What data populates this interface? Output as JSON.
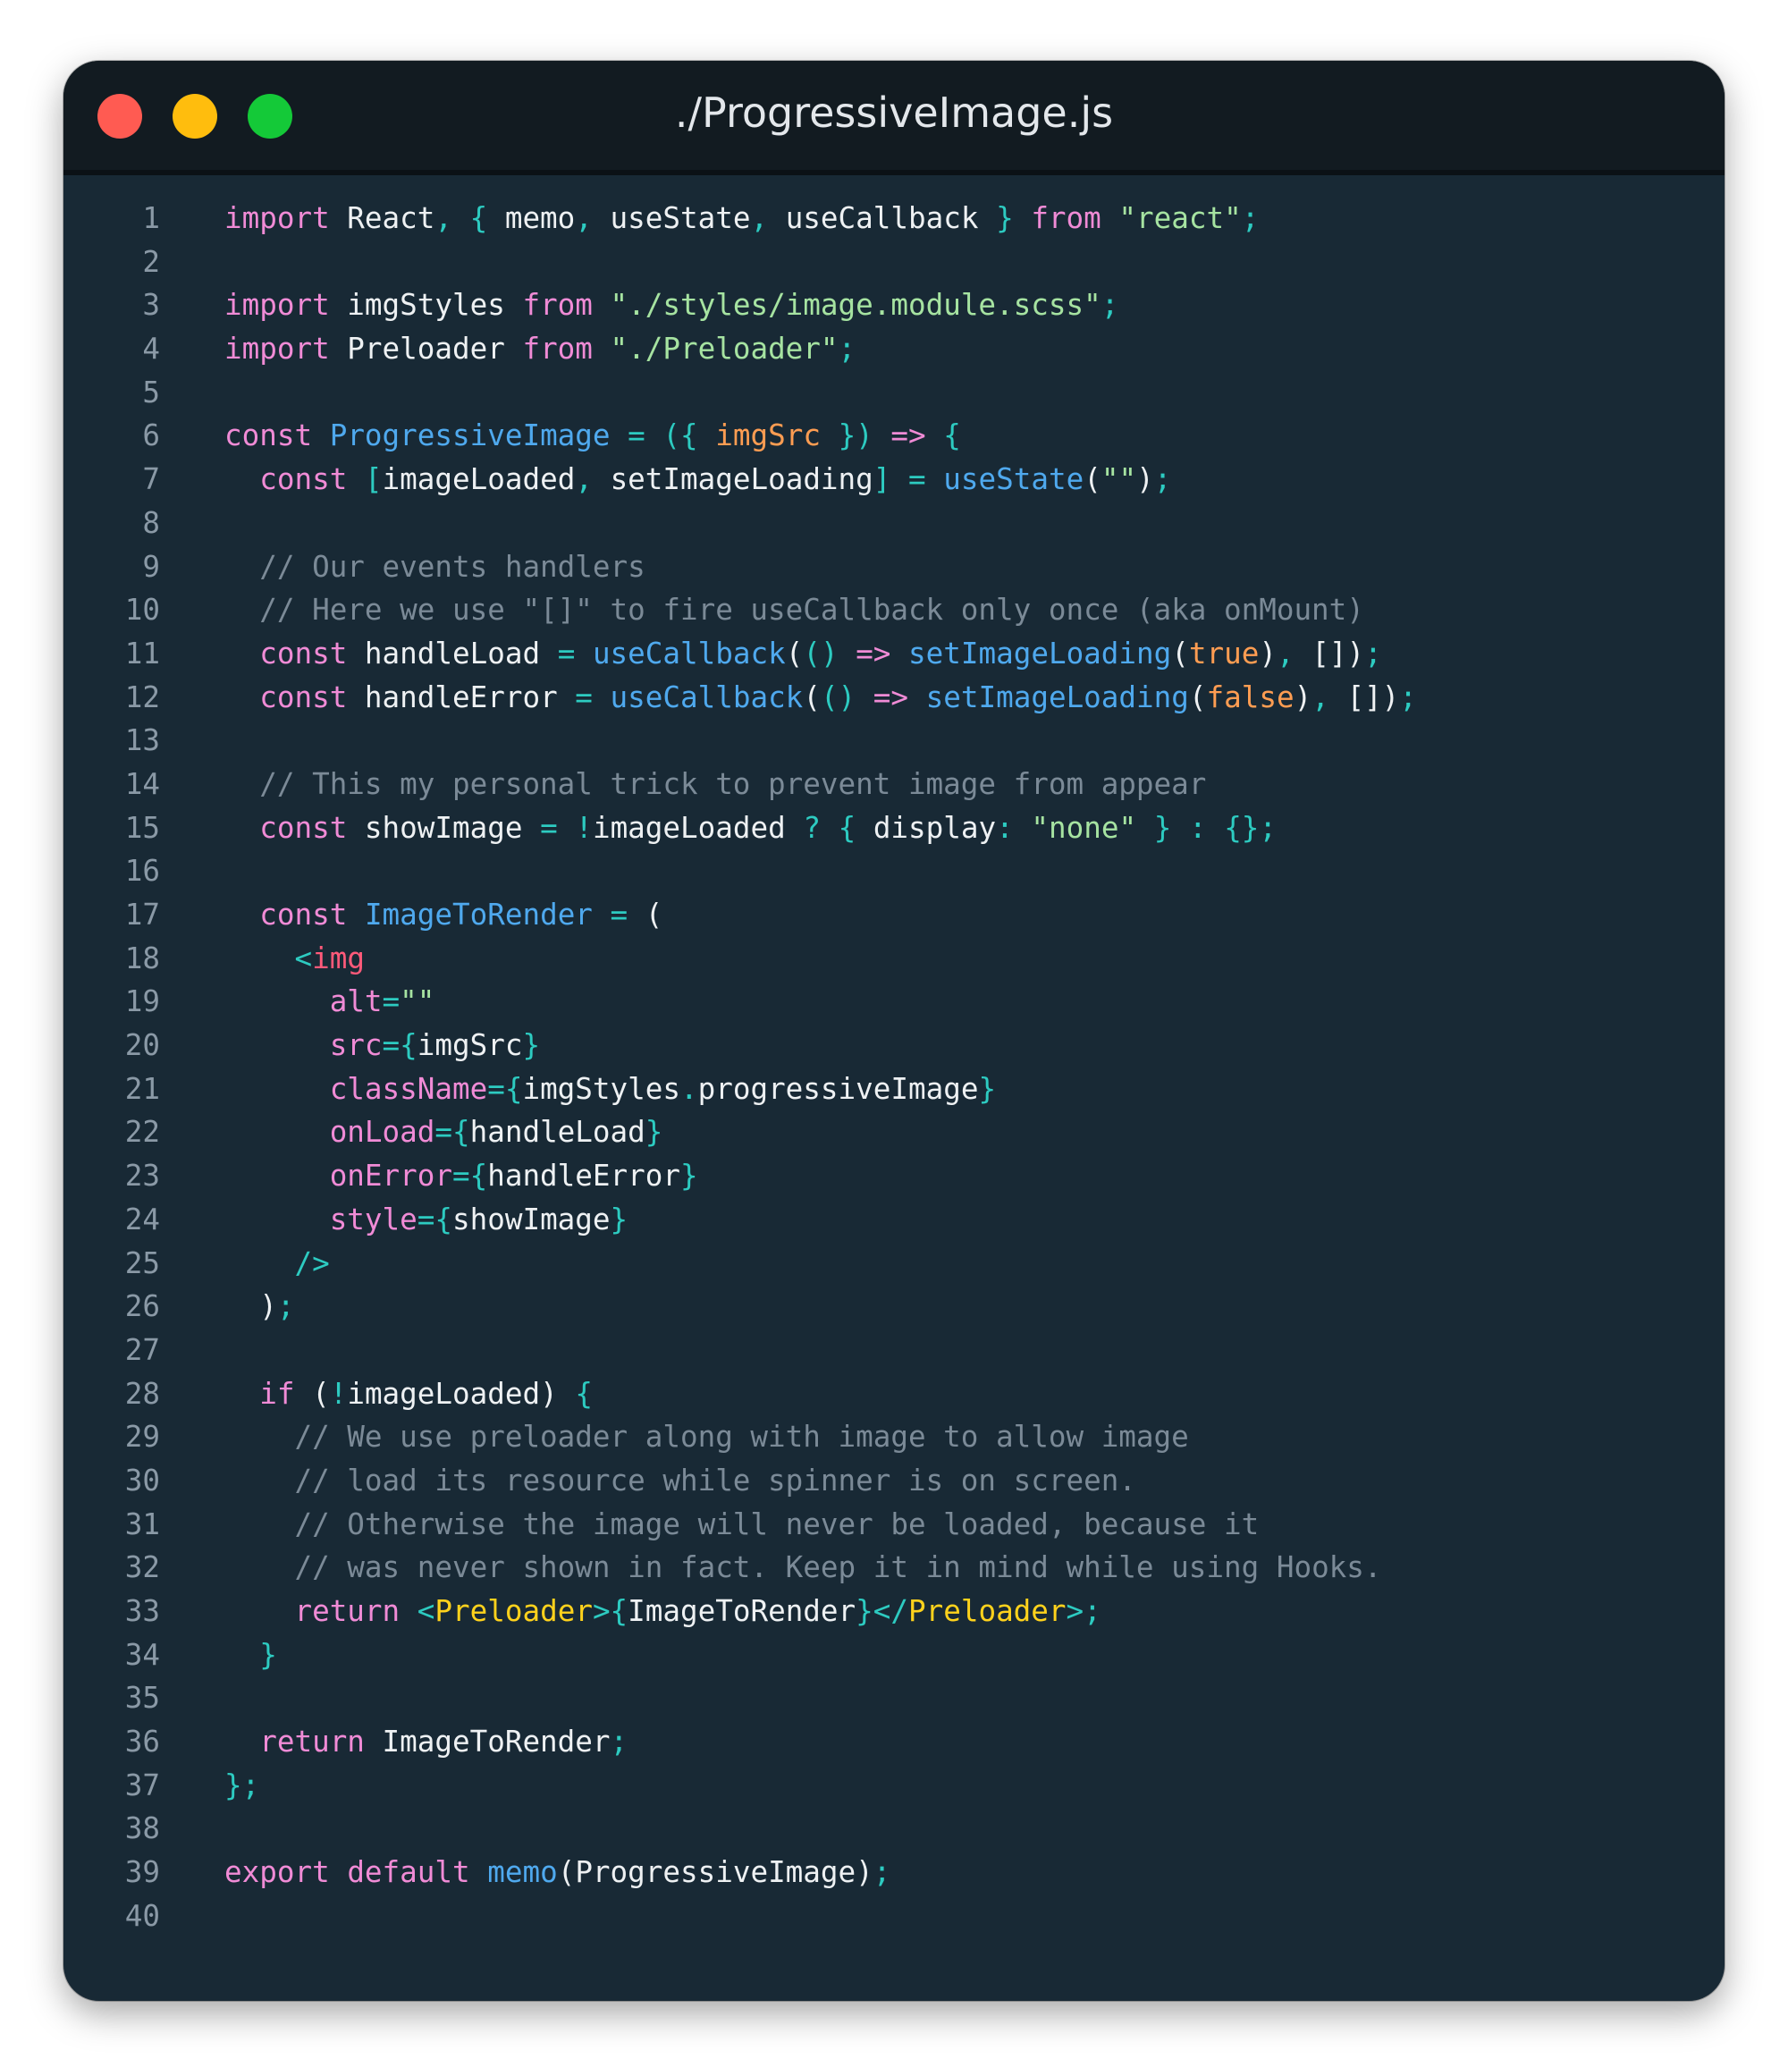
{
  "window": {
    "title": "./ProgressiveImage.js",
    "controls": {
      "close_color": "#ff5b52",
      "minimize_color": "#ffbd0d",
      "maximize_color": "#14c938"
    }
  },
  "editor": {
    "language": "javascript",
    "lines": [
      [
        {
          "t": "kw",
          "s": "import"
        },
        {
          "t": "txt",
          "s": " React"
        },
        {
          "t": "pn",
          "s": ", {"
        },
        {
          "t": "txt",
          "s": " memo"
        },
        {
          "t": "pn",
          "s": ","
        },
        {
          "t": "txt",
          "s": " useState"
        },
        {
          "t": "pn",
          "s": ","
        },
        {
          "t": "txt",
          "s": " useCallback "
        },
        {
          "t": "pn",
          "s": "}"
        },
        {
          "t": "txt",
          "s": " "
        },
        {
          "t": "kw",
          "s": "from"
        },
        {
          "t": "txt",
          "s": " "
        },
        {
          "t": "str",
          "s": "\"react\""
        },
        {
          "t": "pn",
          "s": ";"
        }
      ],
      [],
      [
        {
          "t": "kw",
          "s": "import"
        },
        {
          "t": "txt",
          "s": " imgStyles "
        },
        {
          "t": "kw",
          "s": "from"
        },
        {
          "t": "txt",
          "s": " "
        },
        {
          "t": "str",
          "s": "\"./styles/image.module.scss\""
        },
        {
          "t": "pn",
          "s": ";"
        }
      ],
      [
        {
          "t": "kw",
          "s": "import"
        },
        {
          "t": "txt",
          "s": " Preloader "
        },
        {
          "t": "kw",
          "s": "from"
        },
        {
          "t": "txt",
          "s": " "
        },
        {
          "t": "str",
          "s": "\"./Preloader\""
        },
        {
          "t": "pn",
          "s": ";"
        }
      ],
      [],
      [
        {
          "t": "kw",
          "s": "const"
        },
        {
          "t": "txt",
          "s": " "
        },
        {
          "t": "fn",
          "s": "ProgressiveImage"
        },
        {
          "t": "txt",
          "s": " "
        },
        {
          "t": "pn",
          "s": "= ({"
        },
        {
          "t": "txt",
          "s": " "
        },
        {
          "t": "prm",
          "s": "imgSrc"
        },
        {
          "t": "txt",
          "s": " "
        },
        {
          "t": "pn",
          "s": "})"
        },
        {
          "t": "txt",
          "s": " "
        },
        {
          "t": "kw",
          "s": "=>"
        },
        {
          "t": "txt",
          "s": " "
        },
        {
          "t": "pn",
          "s": "{"
        }
      ],
      [
        {
          "t": "txt",
          "s": "  "
        },
        {
          "t": "kw",
          "s": "const"
        },
        {
          "t": "txt",
          "s": " "
        },
        {
          "t": "pn",
          "s": "["
        },
        {
          "t": "txt",
          "s": "imageLoaded"
        },
        {
          "t": "pn",
          "s": ","
        },
        {
          "t": "txt",
          "s": " setImageLoading"
        },
        {
          "t": "pn",
          "s": "]"
        },
        {
          "t": "txt",
          "s": " "
        },
        {
          "t": "pn",
          "s": "="
        },
        {
          "t": "txt",
          "s": " "
        },
        {
          "t": "fn",
          "s": "useState"
        },
        {
          "t": "txt",
          "s": "("
        },
        {
          "t": "str",
          "s": "\"\""
        },
        {
          "t": "txt",
          "s": ")"
        },
        {
          "t": "pn",
          "s": ";"
        }
      ],
      [],
      [
        {
          "t": "txt",
          "s": "  "
        },
        {
          "t": "cm",
          "s": "// Our events handlers"
        }
      ],
      [
        {
          "t": "txt",
          "s": "  "
        },
        {
          "t": "cm",
          "s": "// Here we use \"[]\" to fire useCallback only once (aka onMount)"
        }
      ],
      [
        {
          "t": "txt",
          "s": "  "
        },
        {
          "t": "kw",
          "s": "const"
        },
        {
          "t": "txt",
          "s": " handleLoad "
        },
        {
          "t": "pn",
          "s": "="
        },
        {
          "t": "txt",
          "s": " "
        },
        {
          "t": "fn",
          "s": "useCallback"
        },
        {
          "t": "txt",
          "s": "("
        },
        {
          "t": "pn",
          "s": "()"
        },
        {
          "t": "txt",
          "s": " "
        },
        {
          "t": "kw",
          "s": "=>"
        },
        {
          "t": "txt",
          "s": " "
        },
        {
          "t": "fn",
          "s": "setImageLoading"
        },
        {
          "t": "txt",
          "s": "("
        },
        {
          "t": "bool",
          "s": "true"
        },
        {
          "t": "txt",
          "s": ")"
        },
        {
          "t": "pn",
          "s": ","
        },
        {
          "t": "txt",
          "s": " []"
        },
        {
          "t": "txt",
          "s": ")"
        },
        {
          "t": "pn",
          "s": ";"
        }
      ],
      [
        {
          "t": "txt",
          "s": "  "
        },
        {
          "t": "kw",
          "s": "const"
        },
        {
          "t": "txt",
          "s": " handleError "
        },
        {
          "t": "pn",
          "s": "="
        },
        {
          "t": "txt",
          "s": " "
        },
        {
          "t": "fn",
          "s": "useCallback"
        },
        {
          "t": "txt",
          "s": "("
        },
        {
          "t": "pn",
          "s": "()"
        },
        {
          "t": "txt",
          "s": " "
        },
        {
          "t": "kw",
          "s": "=>"
        },
        {
          "t": "txt",
          "s": " "
        },
        {
          "t": "fn",
          "s": "setImageLoading"
        },
        {
          "t": "txt",
          "s": "("
        },
        {
          "t": "bool",
          "s": "false"
        },
        {
          "t": "txt",
          "s": ")"
        },
        {
          "t": "pn",
          "s": ","
        },
        {
          "t": "txt",
          "s": " []"
        },
        {
          "t": "txt",
          "s": ")"
        },
        {
          "t": "pn",
          "s": ";"
        }
      ],
      [],
      [
        {
          "t": "txt",
          "s": "  "
        },
        {
          "t": "cm",
          "s": "// This my personal trick to prevent image from appear"
        }
      ],
      [
        {
          "t": "txt",
          "s": "  "
        },
        {
          "t": "kw",
          "s": "const"
        },
        {
          "t": "txt",
          "s": " showImage "
        },
        {
          "t": "pn",
          "s": "="
        },
        {
          "t": "txt",
          "s": " "
        },
        {
          "t": "pn",
          "s": "!"
        },
        {
          "t": "txt",
          "s": "imageLoaded "
        },
        {
          "t": "pn",
          "s": "?"
        },
        {
          "t": "txt",
          "s": " "
        },
        {
          "t": "pn",
          "s": "{"
        },
        {
          "t": "txt",
          "s": " display"
        },
        {
          "t": "pn",
          "s": ":"
        },
        {
          "t": "txt",
          "s": " "
        },
        {
          "t": "str",
          "s": "\"none\""
        },
        {
          "t": "txt",
          "s": " "
        },
        {
          "t": "pn",
          "s": "}"
        },
        {
          "t": "txt",
          "s": " "
        },
        {
          "t": "pn",
          "s": ":"
        },
        {
          "t": "txt",
          "s": " "
        },
        {
          "t": "pn",
          "s": "{}"
        },
        {
          "t": "pn",
          "s": ";"
        }
      ],
      [],
      [
        {
          "t": "txt",
          "s": "  "
        },
        {
          "t": "kw",
          "s": "const"
        },
        {
          "t": "txt",
          "s": " "
        },
        {
          "t": "fn",
          "s": "ImageToRender"
        },
        {
          "t": "txt",
          "s": " "
        },
        {
          "t": "pn",
          "s": "="
        },
        {
          "t": "txt",
          "s": " ("
        }
      ],
      [
        {
          "t": "txt",
          "s": "    "
        },
        {
          "t": "pn",
          "s": "<"
        },
        {
          "t": "tag",
          "s": "img"
        }
      ],
      [
        {
          "t": "txt",
          "s": "      "
        },
        {
          "t": "attr",
          "s": "alt"
        },
        {
          "t": "pn",
          "s": "="
        },
        {
          "t": "str",
          "s": "\"\""
        }
      ],
      [
        {
          "t": "txt",
          "s": "      "
        },
        {
          "t": "attr",
          "s": "src"
        },
        {
          "t": "pn",
          "s": "={"
        },
        {
          "t": "txt",
          "s": "imgSrc"
        },
        {
          "t": "pn",
          "s": "}"
        }
      ],
      [
        {
          "t": "txt",
          "s": "      "
        },
        {
          "t": "attr",
          "s": "className"
        },
        {
          "t": "pn",
          "s": "={"
        },
        {
          "t": "txt",
          "s": "imgStyles"
        },
        {
          "t": "pn",
          "s": "."
        },
        {
          "t": "txt",
          "s": "progressiveImage"
        },
        {
          "t": "pn",
          "s": "}"
        }
      ],
      [
        {
          "t": "txt",
          "s": "      "
        },
        {
          "t": "attr",
          "s": "onLoad"
        },
        {
          "t": "pn",
          "s": "={"
        },
        {
          "t": "txt",
          "s": "handleLoad"
        },
        {
          "t": "pn",
          "s": "}"
        }
      ],
      [
        {
          "t": "txt",
          "s": "      "
        },
        {
          "t": "attr",
          "s": "onError"
        },
        {
          "t": "pn",
          "s": "={"
        },
        {
          "t": "txt",
          "s": "handleError"
        },
        {
          "t": "pn",
          "s": "}"
        }
      ],
      [
        {
          "t": "txt",
          "s": "      "
        },
        {
          "t": "attr",
          "s": "style"
        },
        {
          "t": "pn",
          "s": "={"
        },
        {
          "t": "txt",
          "s": "showImage"
        },
        {
          "t": "pn",
          "s": "}"
        }
      ],
      [
        {
          "t": "txt",
          "s": "    "
        },
        {
          "t": "pn",
          "s": "/>"
        }
      ],
      [
        {
          "t": "txt",
          "s": "  )"
        },
        {
          "t": "pn",
          "s": ";"
        }
      ],
      [],
      [
        {
          "t": "txt",
          "s": "  "
        },
        {
          "t": "kw",
          "s": "if"
        },
        {
          "t": "txt",
          "s": " ("
        },
        {
          "t": "pn",
          "s": "!"
        },
        {
          "t": "txt",
          "s": "imageLoaded) "
        },
        {
          "t": "pn",
          "s": "{"
        }
      ],
      [
        {
          "t": "txt",
          "s": "    "
        },
        {
          "t": "cm",
          "s": "// We use preloader along with image to allow image"
        }
      ],
      [
        {
          "t": "txt",
          "s": "    "
        },
        {
          "t": "cm",
          "s": "// load its resource while spinner is on screen."
        }
      ],
      [
        {
          "t": "txt",
          "s": "    "
        },
        {
          "t": "cm",
          "s": "// Otherwise the image will never be loaded, because it"
        }
      ],
      [
        {
          "t": "txt",
          "s": "    "
        },
        {
          "t": "cm",
          "s": "// was never shown in fact. Keep it in mind while using Hooks."
        }
      ],
      [
        {
          "t": "txt",
          "s": "    "
        },
        {
          "t": "kw",
          "s": "return"
        },
        {
          "t": "txt",
          "s": " "
        },
        {
          "t": "pn",
          "s": "<"
        },
        {
          "t": "comp",
          "s": "Preloader"
        },
        {
          "t": "pn",
          "s": ">{"
        },
        {
          "t": "txt",
          "s": "ImageToRender"
        },
        {
          "t": "pn",
          "s": "}</"
        },
        {
          "t": "comp",
          "s": "Preloader"
        },
        {
          "t": "pn",
          "s": ">;"
        }
      ],
      [
        {
          "t": "txt",
          "s": "  "
        },
        {
          "t": "pn",
          "s": "}"
        }
      ],
      [],
      [
        {
          "t": "txt",
          "s": "  "
        },
        {
          "t": "kw",
          "s": "return"
        },
        {
          "t": "txt",
          "s": " ImageToRender"
        },
        {
          "t": "pn",
          "s": ";"
        }
      ],
      [
        {
          "t": "pn",
          "s": "};"
        }
      ],
      [],
      [
        {
          "t": "kw",
          "s": "export"
        },
        {
          "t": "txt",
          "s": " "
        },
        {
          "t": "kw",
          "s": "default"
        },
        {
          "t": "txt",
          "s": " "
        },
        {
          "t": "fn",
          "s": "memo"
        },
        {
          "t": "txt",
          "s": "(ProgressiveImage)"
        },
        {
          "t": "pn",
          "s": ";"
        }
      ],
      []
    ]
  }
}
